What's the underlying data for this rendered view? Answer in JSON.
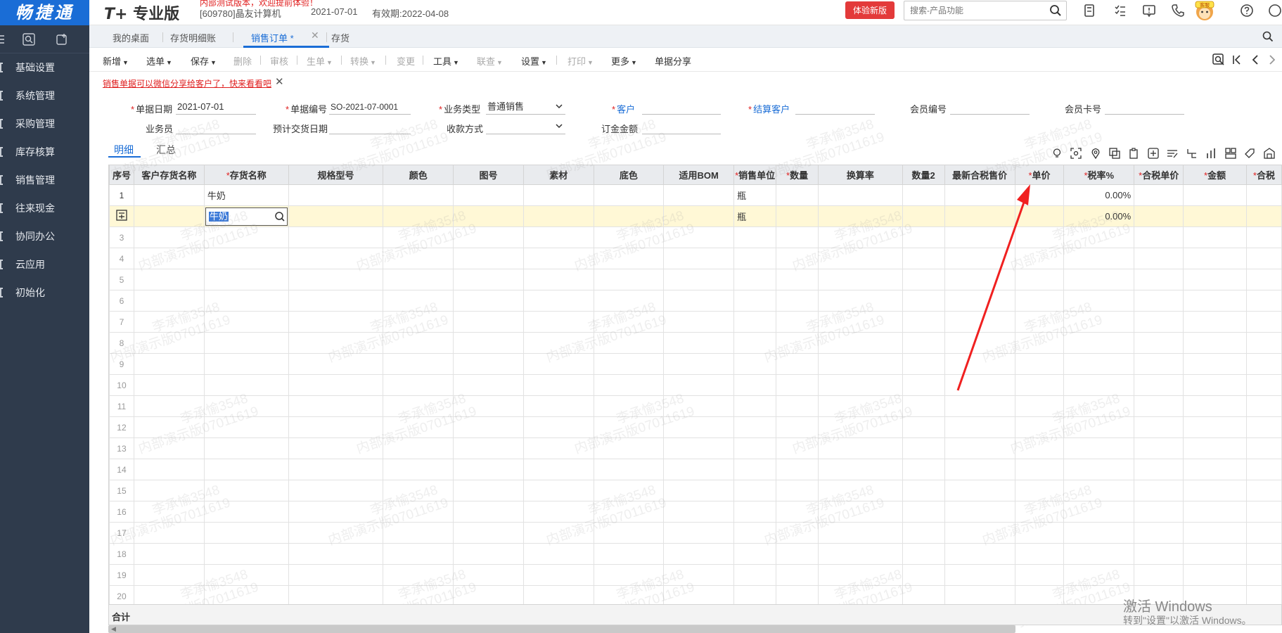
{
  "header": {
    "logo": "畅捷通",
    "brand_prefix": "T+",
    "brand_name": "专业版",
    "promo": "内部测试版本，欢迎提前体验！",
    "company": "[609780]晶友计算机",
    "date": "2021-07-01",
    "validity": "有效期:2022-04-08",
    "try_button": "体验新版",
    "search_placeholder": "搜索-产品功能",
    "mascot_label": "客服"
  },
  "sidebar": {
    "items": [
      "基础设置",
      "系统管理",
      "采购管理",
      "库存核算",
      "销售管理",
      "往来现金",
      "协同办公",
      "云应用",
      "初始化"
    ]
  },
  "tabs": [
    "我的桌面",
    "存货明细账",
    "销售订单 *",
    "存货"
  ],
  "toolbar": {
    "items": [
      {
        "label": "新增",
        "caret": true,
        "disabled": false
      },
      {
        "label": "选单",
        "caret": true,
        "disabled": false
      },
      {
        "label": "保存",
        "caret": true,
        "disabled": false
      },
      {
        "label": "删除",
        "caret": false,
        "disabled": true
      },
      {
        "label": "审核",
        "caret": false,
        "disabled": true
      },
      {
        "label": "生单",
        "caret": true,
        "disabled": true
      },
      {
        "label": "转换",
        "caret": true,
        "disabled": true
      },
      {
        "label": "变更",
        "caret": false,
        "disabled": true
      },
      {
        "label": "工具",
        "caret": true,
        "disabled": false
      },
      {
        "label": "联查",
        "caret": true,
        "disabled": true
      },
      {
        "label": "设置",
        "caret": true,
        "disabled": false
      },
      {
        "label": "打印",
        "caret": true,
        "disabled": true
      },
      {
        "label": "更多",
        "caret": true,
        "disabled": false
      },
      {
        "label": "单据分享",
        "caret": false,
        "disabled": false
      }
    ]
  },
  "notice": "销售单据可以微信分享给客户了，快来看看吧",
  "form": {
    "doc_date_label": "单据日期",
    "doc_date": "2021-07-01",
    "doc_no_label": "单据编号",
    "doc_no": "SO-2021-07-0001",
    "biz_type_label": "业务类型",
    "biz_type": "普通销售",
    "customer_label": "客户",
    "settle_customer_label": "结算客户",
    "member_no_label": "会员编号",
    "member_card_label": "会员卡号",
    "salesman_label": "业务员",
    "delivery_date_label": "预计交货日期",
    "payment_label": "收款方式",
    "deposit_label": "订金金额"
  },
  "subtabs": {
    "detail": "明细",
    "summary": "汇总"
  },
  "grid": {
    "columns": [
      {
        "label": "序号",
        "req": false
      },
      {
        "label": "客户存货名称",
        "req": false
      },
      {
        "label": "存货名称",
        "req": true
      },
      {
        "label": "规格型号",
        "req": false
      },
      {
        "label": "颜色",
        "req": false
      },
      {
        "label": "图号",
        "req": false
      },
      {
        "label": "素材",
        "req": false
      },
      {
        "label": "底色",
        "req": false
      },
      {
        "label": "适用BOM",
        "req": false
      },
      {
        "label": "销售单位",
        "req": true
      },
      {
        "label": "数量",
        "req": true
      },
      {
        "label": "换算率",
        "req": false
      },
      {
        "label": "数量2",
        "req": false
      },
      {
        "label": "最新合税售价",
        "req": false
      },
      {
        "label": "单价",
        "req": true
      },
      {
        "label": "税率%",
        "req": true
      },
      {
        "label": "合税单价",
        "req": true
      },
      {
        "label": "金额",
        "req": true
      },
      {
        "label": "合税",
        "req": true
      }
    ],
    "row1": {
      "no": "1",
      "item": "牛奶",
      "unit": "瓶",
      "tax_rate": "0.00%"
    },
    "row2": {
      "item": "牛奶",
      "unit": "瓶",
      "tax_rate": "0.00%"
    },
    "row_numbers": [
      "3",
      "4",
      "5",
      "6",
      "7",
      "8",
      "9",
      "10",
      "11",
      "12",
      "13",
      "14",
      "15",
      "16",
      "17",
      "18",
      "19",
      "20"
    ],
    "total_label": "合计"
  },
  "watermark": {
    "line1": "李承愉3548",
    "line2": "内部演示版07011619"
  },
  "activation": {
    "title": "激活 Windows",
    "subtitle": "转到\"设置\"以激活 Windows。"
  },
  "colors": {
    "brand_blue": "#1a6dd6",
    "sidebar_bg": "#2f3b4c",
    "alert_red": "#e02020",
    "selected_row": "#fff8d6"
  }
}
